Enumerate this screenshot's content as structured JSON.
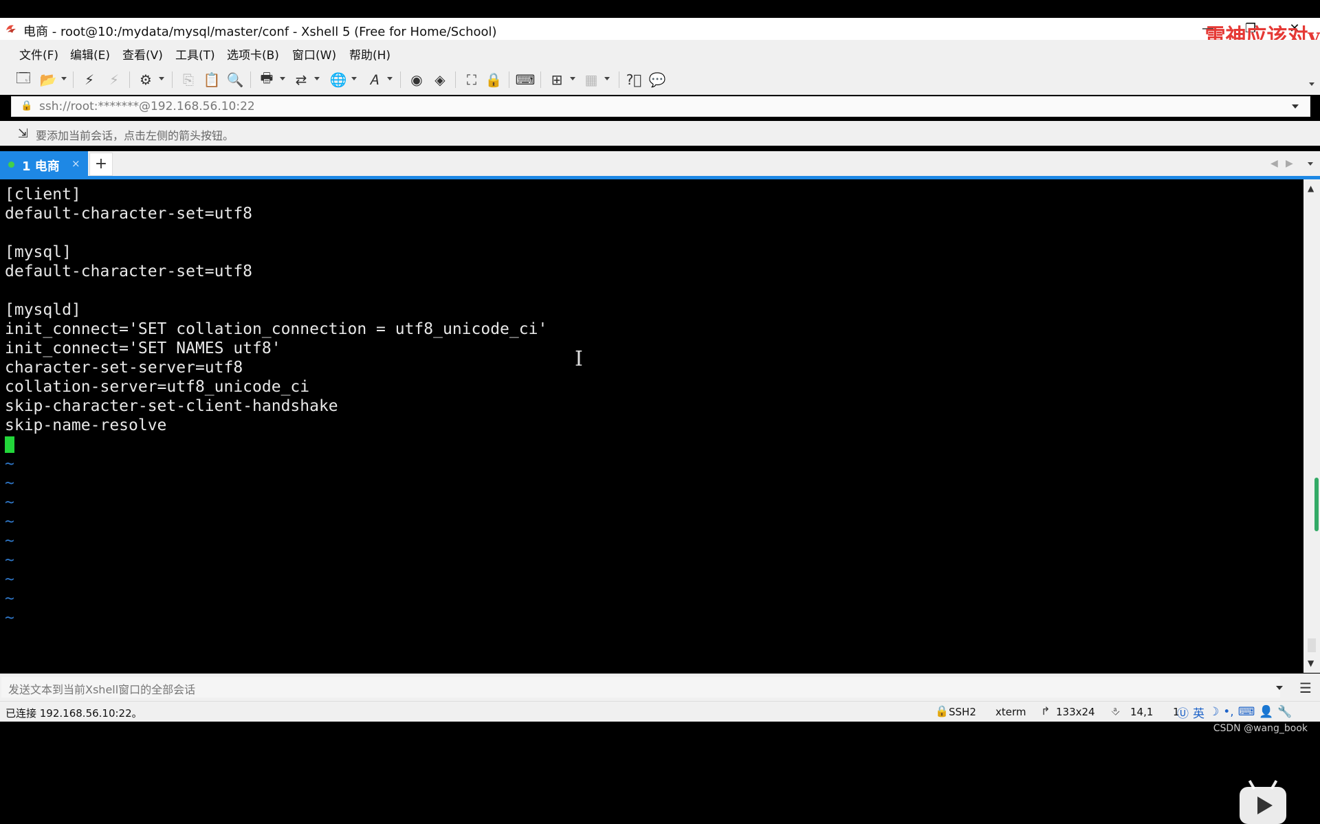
{
  "titlebar": {
    "title": "电商 - root@10:/mydata/mysql/master/conf - Xshell 5 (Free for Home/School)",
    "watermark": "雷神应该对v"
  },
  "menu": [
    "文件(F)",
    "编辑(E)",
    "查看(V)",
    "工具(T)",
    "选项卡(B)",
    "窗口(W)",
    "帮助(H)"
  ],
  "address": {
    "value": "ssh://root:*******@192.168.56.10:22"
  },
  "hint": {
    "text": "要添加当前会话，点击左侧的箭头按钮。"
  },
  "tab": {
    "label": "1 电商",
    "close": "×",
    "add": "+"
  },
  "terminal": {
    "lines": [
      "[client]",
      "default-character-set=utf8",
      "",
      "[mysql]",
      "default-character-set=utf8",
      "",
      "[mysqld]",
      "init_connect='SET collation_connection = utf8_unicode_ci'",
      "init_connect='SET NAMES utf8'",
      "character-set-server=utf8",
      "collation-server=utf8_unicode_ci",
      "skip-character-set-client-handshake",
      "skip-name-resolve"
    ],
    "tilde": "~"
  },
  "sendbar": {
    "placeholder": "发送文本到当前Xshell窗口的全部会话"
  },
  "status": {
    "connection": "已连接 192.168.56.10:22。",
    "protocol": "SSH2",
    "terminal_type": "xterm",
    "size": "133x24",
    "cursor_pos": "14,1",
    "extra": "1",
    "ime_lang": "英"
  },
  "footer": {
    "credit": "CSDN @wang_book"
  },
  "colors": {
    "accent": "#1e88e5",
    "cursor": "#22d63a",
    "tilde": "#2f77c8",
    "watermark": "#e53935"
  }
}
